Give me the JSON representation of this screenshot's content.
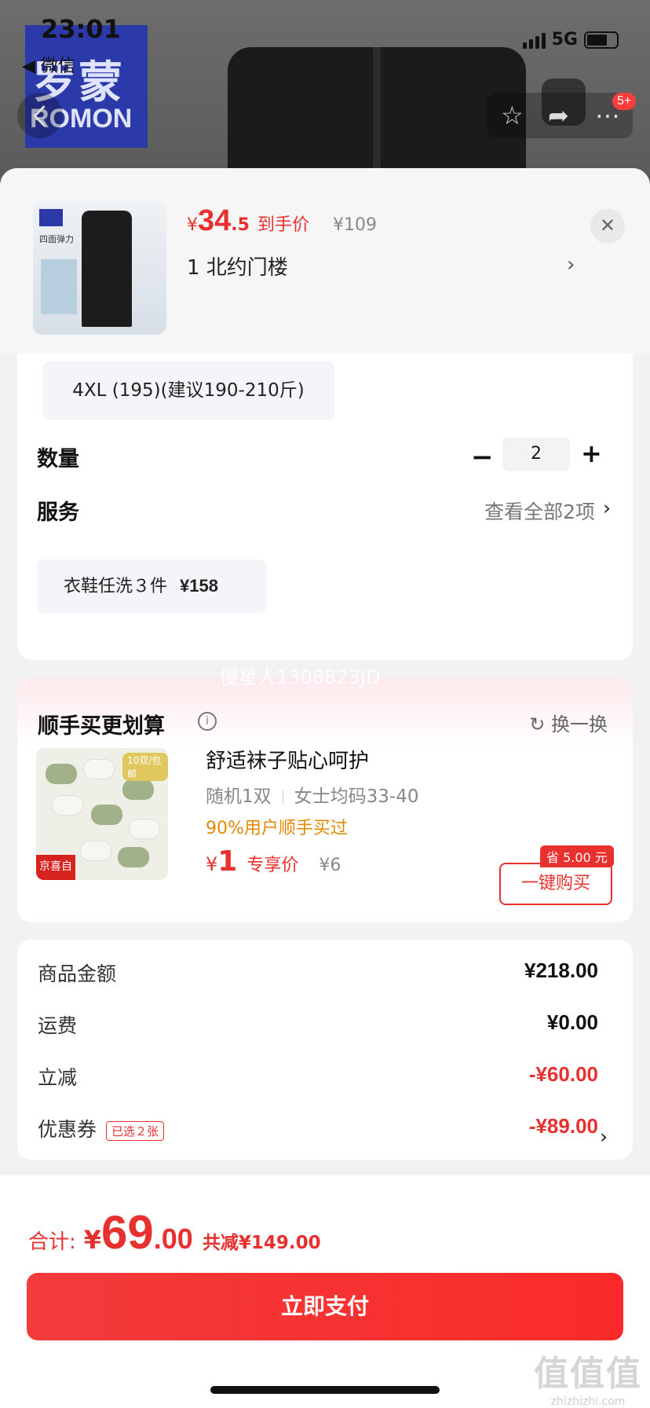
{
  "status": {
    "time": "23:01",
    "back_app": "◀ 微信",
    "network": "5G"
  },
  "nav": {
    "badge": "5+",
    "logo_cn": "罗蒙",
    "logo_en": "ROMON"
  },
  "product": {
    "currency": "¥",
    "price_int": "34",
    "price_dec": ".5",
    "price_label": "到手价",
    "original_price": "¥109",
    "address": "1  北约门楼",
    "thumb_text": "四面弹力"
  },
  "options": {
    "size": "4XL (195)(建议190-210斤)",
    "quantity_label": "数量",
    "quantity": "2",
    "service_label": "服务",
    "service_more": "查看全部2项",
    "service_item": "衣鞋任洗３件",
    "service_price": "¥158"
  },
  "addon": {
    "watermark": "慢星人1308823JD",
    "title": "顺手买更划算",
    "swap": "换一换",
    "name": "舒适袜子贴心呵护",
    "spec1": "随机1双",
    "spec2": "女士均码33-40",
    "hint": "90%用户顺手买过",
    "currency": "¥",
    "price": "1",
    "price_label": "专享价",
    "original_price": "¥6",
    "save_tag": "省 5.00 元",
    "buy_label": "一键购买",
    "badge": "京喜自营 包邮",
    "img_tag": "10双/包邮"
  },
  "summary": {
    "goods_label": "商品金额",
    "goods_value": "¥218.00",
    "shipping_label": "运费",
    "shipping_value": "¥0.00",
    "discount_label": "立减",
    "discount_value": "-¥60.00",
    "coupon_label": "优惠券",
    "coupon_tag": "已选２张",
    "coupon_value": "-¥89.00"
  },
  "footer": {
    "total_label": "合计:",
    "total_currency": "¥",
    "total_int": "69",
    "total_dec": ".00",
    "total_saved": "共减¥149.00",
    "pay_label": "立即支付",
    "corner_big": "值值值",
    "corner_small": "zhizhizhi.com"
  },
  "colors": {
    "accent": "#e8312f",
    "hint": "#e08a00"
  }
}
